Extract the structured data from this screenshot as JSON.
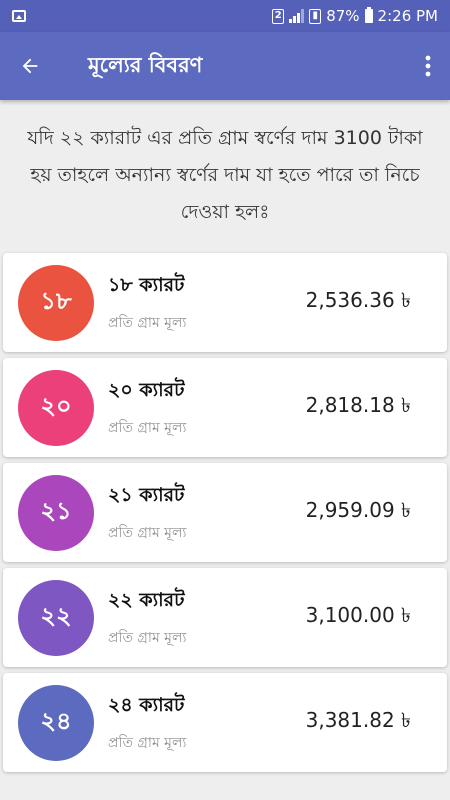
{
  "status_bar": {
    "sim_label": "2",
    "battery": "87%",
    "time": "2:26 PM"
  },
  "app_bar": {
    "title": "মূল্যের বিবরণ"
  },
  "intro": {
    "text": "যদি ২২ ক্যারাট এর প্রতি গ্রাম স্বর্ণের দাম 3100 টাকা হয় তাহলে অন্যান্য স্বর্ণের দাম যা হতে পারে তা নিচে দেওয়া হলঃ"
  },
  "items": [
    {
      "badge": "১৮",
      "name": "১৮ ক্যারট",
      "subtitle": "প্রতি গ্রাম মূল্য",
      "price": "2,536.36 ৳",
      "color": "#e9533f"
    },
    {
      "badge": "২০",
      "name": "২০ ক্যারট",
      "subtitle": "প্রতি গ্রাম মূল্য",
      "price": "2,818.18 ৳",
      "color": "#ec407a"
    },
    {
      "badge": "২১",
      "name": "২১ ক্যারট",
      "subtitle": "প্রতি গ্রাম মূল্য",
      "price": "2,959.09 ৳",
      "color": "#ab47bc"
    },
    {
      "badge": "২২",
      "name": "২২ ক্যারট",
      "subtitle": "প্রতি গ্রাম মূল্য",
      "price": "3,100.00 ৳",
      "color": "#7e57c2"
    },
    {
      "badge": "২৪",
      "name": "২৪ ক্যারট",
      "subtitle": "প্রতি গ্রাম মূল্য",
      "price": "3,381.82 ৳",
      "color": "#5c6bc0"
    }
  ],
  "colors": {
    "status_bar": "#5560b8",
    "app_bar": "#5c6bc0",
    "background": "#eeeeee"
  }
}
